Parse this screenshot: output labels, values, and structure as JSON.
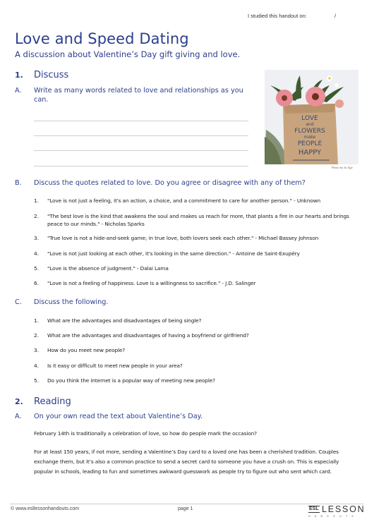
{
  "header": {
    "studied_label": "I studied this handout on:",
    "studied_slash": "/"
  },
  "title": "Love and Speed Dating",
  "subtitle": "A discussion about Valentine’s Day gift giving and love.",
  "sections": [
    {
      "number": "1.",
      "label": "Discuss",
      "parts": [
        {
          "letter": "A.",
          "heading": "Write as many words related to love and relationships as you can.",
          "write_lines": 4
        },
        {
          "letter": "B.",
          "heading": "Discuss the quotes related to love.  Do you agree or disagree with any of them?",
          "items": [
            {
              "n": "1.",
              "text": "\"Love is not just a feeling, it's an action, a choice, and a commitment to care for another person.\" - Unknown"
            },
            {
              "n": "2.",
              "text": "\"The best love is the kind that awakens the soul and makes us reach for more, that plants a fire in our hearts and brings peace to our minds.\" - Nicholas Sparks"
            },
            {
              "n": "3.",
              "text": "\"True love is not a hide-and-seek game; in true love, both lovers seek each other.\" - Michael Bassey Johnson"
            },
            {
              "n": "4.",
              "text": "\"Love is not just looking at each other, it's looking in the same direction.\" - Antoine de Saint-Exupéry"
            },
            {
              "n": "5.",
              "text": "\"Love is the absence of judgment.\" - Dalai Lama"
            },
            {
              "n": "6.",
              "text": "\"Love is not a feeling of happiness.  Love is a willingness to sacrifice.\" - J.D. Salinger"
            }
          ]
        },
        {
          "letter": "C.",
          "heading": "Discuss the following.",
          "items": [
            {
              "n": "1.",
              "text": "What are the advantages and disadvantages of being single?"
            },
            {
              "n": "2.",
              "text": "What are the advantages and disadvantages of having a boyfriend or girlfriend?"
            },
            {
              "n": "3.",
              "text": "How do you meet new people?"
            },
            {
              "n": "4.",
              "text": "Is it easy or difficult to meet new people in your area?"
            },
            {
              "n": "5.",
              "text": "Do you think the Internet is a popular way of meeting new people?"
            }
          ]
        }
      ]
    },
    {
      "number": "2.",
      "label": "Reading",
      "parts": [
        {
          "letter": "A.",
          "heading": "On your own read the text about Valentine’s Day.",
          "paragraphs": [
            "February 14th is traditionally a celebration of love, so how do people mark the occasion?",
            "For at least 150 years, if not more, sending a Valentine’s Day card to a loved one has been a cherished tradition.  Couples exchange them, but it’s also a common practice to send a secret card to someone you have a crush on.  This is especially popular in schools, leading to fun and sometimes awkward guesswork as people try to figure out who sent which card."
          ]
        }
      ]
    }
  ],
  "photo": {
    "caption_words": [
      "LOVE",
      "and",
      "FLOWERS",
      "make",
      "PEOPLE",
      "HAPPY"
    ],
    "credit": "Photo by bi Age"
  },
  "footer": {
    "copyright": "© www.esllessonhandouts.com",
    "page": "page 1",
    "logo_esl": "ESL",
    "logo_lesson": "LESSON",
    "logo_handouts": "HANDOUTS"
  },
  "colors": {
    "accent": "#2c3e8c",
    "body_text": "#222222",
    "rule": "#cfcfcf"
  }
}
